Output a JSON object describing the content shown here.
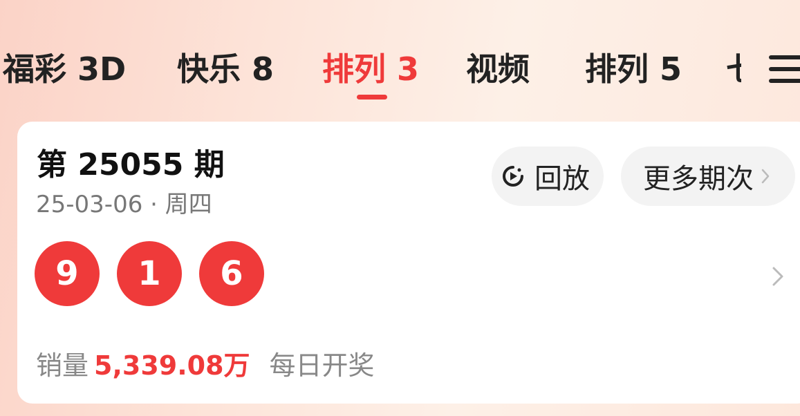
{
  "tabs": [
    {
      "label": "福彩 3D",
      "active": false
    },
    {
      "label": "快乐 8",
      "active": false
    },
    {
      "label": "排列 3",
      "active": true
    },
    {
      "label": "视频",
      "active": false
    },
    {
      "label": "排列 5",
      "active": false
    }
  ],
  "tabs_partial_next": "七",
  "colors": {
    "accent": "#ef3a3a",
    "text_primary": "#222222",
    "text_secondary": "#888888",
    "pill_bg": "#f3f3f3"
  },
  "icons": {
    "menu": "menu-icon",
    "replay": "replay-icon",
    "chevron": "chevron-right-icon"
  },
  "card": {
    "issue_title": "第 25055 期",
    "date_text": "25-03-06 · 周四",
    "replay_label": "回放",
    "more_label": "更多期次",
    "numbers": [
      "9",
      "1",
      "6"
    ],
    "sales_label": "销量",
    "sales_amount": "5,339.08万",
    "draw_frequency": "每日开奖"
  }
}
